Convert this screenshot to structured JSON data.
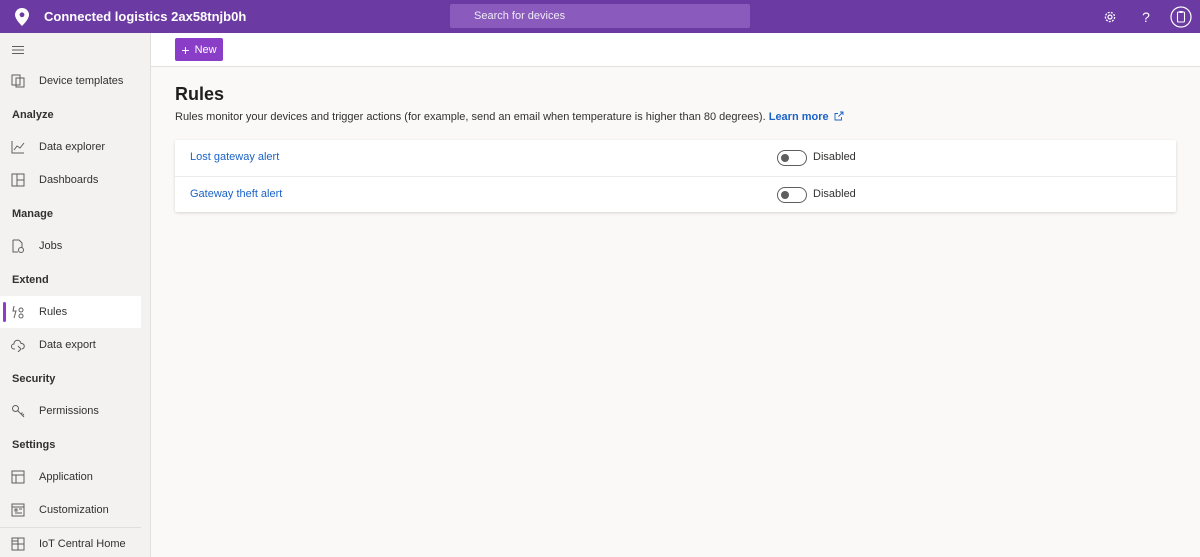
{
  "app": {
    "title": "Connected logistics 2ax58tnjb0h",
    "search_placeholder": "Search for devices",
    "accent": "#6b3aa3",
    "icons": [
      "location-pin-icon",
      "settings-gear-icon",
      "help-icon",
      "user-account-icon"
    ]
  },
  "sidebar": {
    "items": [
      {
        "label": "Device templates",
        "icon": "device-templates-icon"
      },
      {
        "label": "Data explorer",
        "icon": "chart-line-icon"
      },
      {
        "label": "Dashboards",
        "icon": "dashboard-grid-icon"
      },
      {
        "label": "Jobs",
        "icon": "jobs-document-icon"
      },
      {
        "label": "Rules",
        "icon": "rules-icon",
        "active": true
      },
      {
        "label": "Data export",
        "icon": "cloud-export-icon"
      },
      {
        "label": "Permissions",
        "icon": "key-icon"
      },
      {
        "label": "Application",
        "icon": "application-icon"
      },
      {
        "label": "Customization",
        "icon": "customization-icon"
      },
      {
        "label": "IoT Central Home",
        "icon": "home-grid-icon"
      }
    ],
    "sections": {
      "analyze": "Analyze",
      "manage": "Manage",
      "extend": "Extend",
      "security": "Security",
      "settings": "Settings"
    }
  },
  "toolbar": {
    "new_label": "New"
  },
  "main": {
    "title": "Rules",
    "description": "Rules monitor your devices and trigger actions (for example, send an email when temperature is higher than 80 degrees).",
    "learn_more": "Learn more",
    "rules": [
      {
        "name": "Lost gateway alert",
        "status": "Disabled",
        "enabled": false
      },
      {
        "name": "Gateway theft alert",
        "status": "Disabled",
        "enabled": false
      }
    ]
  }
}
